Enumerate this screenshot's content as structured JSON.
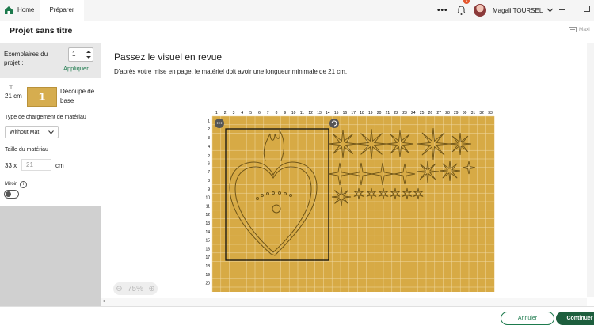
{
  "app": {
    "tabs": [
      {
        "label": "Home"
      },
      {
        "label": "Préparer"
      }
    ],
    "user_name": "Magali TOURSEL",
    "notification_count": "1",
    "more_label": "•••"
  },
  "titlebar": {
    "title": "Projet sans titre",
    "right_label": "Maxi"
  },
  "sidebar": {
    "copies_label": "Exemplaires du projet :",
    "copies_value": "1",
    "apply_label": "Appliquer",
    "mat_length": "21 cm",
    "mat_number": "1",
    "cut_label": "Découpe de base",
    "loading_type_label": "Type de chargement de matériau",
    "loading_type_value": "Without Mat",
    "material_size_label": "Taille du matériau",
    "width_value": "33 x",
    "height_placeholder": "21",
    "unit": "cm",
    "mirror_label": "Miroir"
  },
  "main": {
    "title": "Passez le visuel en revue",
    "subtitle": "D'après votre mise en page, le matériel doit avoir une longueur minimale de 21 cm.",
    "zoom": "75%",
    "col_labels": [
      "1",
      "2",
      "3",
      "4",
      "5",
      "6",
      "7",
      "8",
      "9",
      "10",
      "11",
      "12",
      "13",
      "14",
      "15",
      "16",
      "17",
      "18",
      "19",
      "20",
      "21",
      "22",
      "23",
      "24",
      "25",
      "26",
      "27",
      "28",
      "29",
      "30",
      "31",
      "32",
      "33"
    ],
    "row_labels": [
      "1",
      "2",
      "3",
      "4",
      "5",
      "6",
      "7",
      "8",
      "9",
      "10",
      "11",
      "12",
      "13",
      "14",
      "15",
      "16",
      "17",
      "18",
      "19",
      "20"
    ]
  },
  "footer": {
    "cancel_label": "Annuler",
    "continue_label": "Continuer"
  },
  "colors": {
    "accent": "#1d7a4d",
    "mat": "#d7aa45",
    "grid": "#f0d9a4"
  }
}
